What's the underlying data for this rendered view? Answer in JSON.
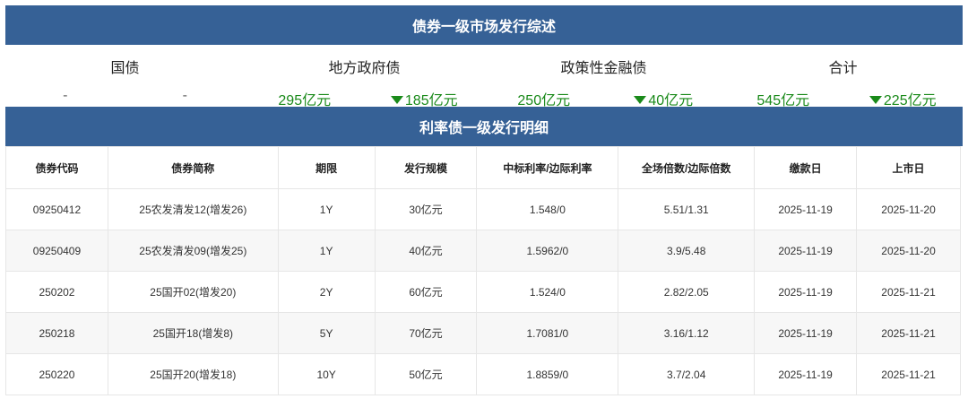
{
  "summary": {
    "title": "债券一级市场发行综述",
    "categories": [
      "国债",
      "地方政府债",
      "政策性金融债",
      "合计"
    ],
    "values": [
      {
        "amount": "-",
        "change": "-",
        "direction": "none"
      },
      {
        "amount": "295亿元",
        "change": "185亿元",
        "direction": "down"
      },
      {
        "amount": "250亿元",
        "change": "40亿元",
        "direction": "down"
      },
      {
        "amount": "545亿元",
        "change": "225亿元",
        "direction": "down"
      }
    ],
    "up_color": "#1a8a1a"
  },
  "detail": {
    "title": "利率债一级发行明细",
    "columns": [
      "债券代码",
      "债券简称",
      "期限",
      "发行规模",
      "中标利率/边际利率",
      "全场倍数/边际倍数",
      "缴款日",
      "上市日"
    ],
    "rows": [
      [
        "09250412",
        "25农发清发12(增发26)",
        "1Y",
        "30亿元",
        "1.548/0",
        "5.51/1.31",
        "2025-11-19",
        "2025-11-20"
      ],
      [
        "09250409",
        "25农发清发09(增发25)",
        "1Y",
        "40亿元",
        "1.5962/0",
        "3.9/5.48",
        "2025-11-19",
        "2025-11-20"
      ],
      [
        "250202",
        "25国开02(增发20)",
        "2Y",
        "60亿元",
        "1.524/0",
        "2.82/2.05",
        "2025-11-19",
        "2025-11-21"
      ],
      [
        "250218",
        "25国开18(增发8)",
        "5Y",
        "70亿元",
        "1.7081/0",
        "3.16/1.12",
        "2025-11-19",
        "2025-11-21"
      ],
      [
        "250220",
        "25国开20(增发18)",
        "10Y",
        "50亿元",
        "1.8859/0",
        "3.7/2.04",
        "2025-11-19",
        "2025-11-21"
      ]
    ]
  },
  "colors": {
    "header_bg": "#366196"
  }
}
